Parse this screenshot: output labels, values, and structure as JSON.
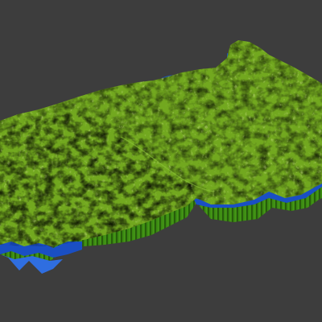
{
  "viewport": {
    "background_color": "#3d3d3d"
  },
  "terrain_model": {
    "top_surface_color": "#72a81f",
    "top_highlight_color": "#8fc63a",
    "top_shadow_color": "#4f7a14",
    "side_wall_color": "#3b8a12",
    "side_wall_shadow_color": "#275c0c",
    "water_color": "#1a4fc4",
    "water_highlight_color": "#2f6ee0"
  }
}
